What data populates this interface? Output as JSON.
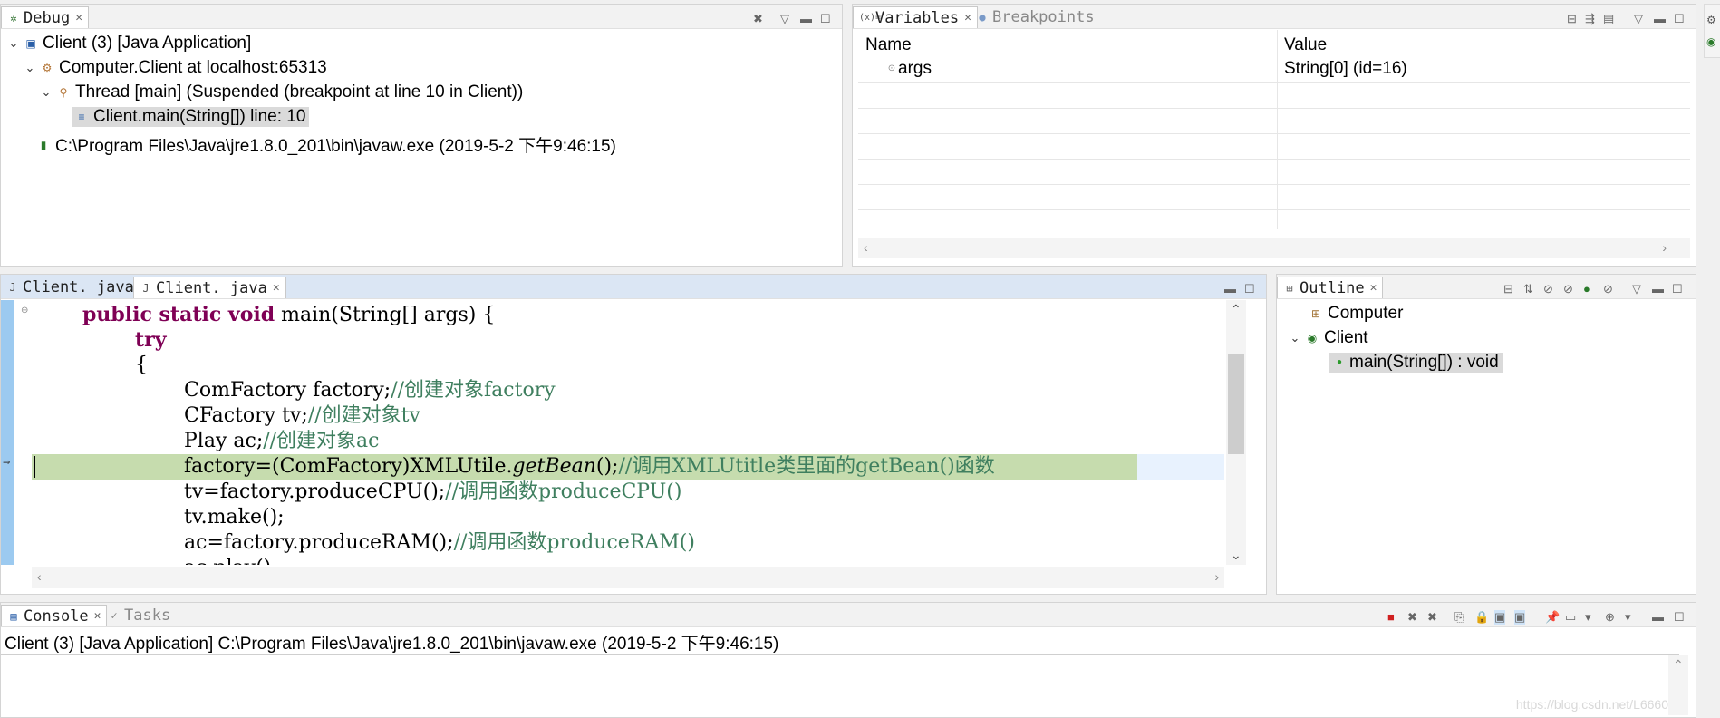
{
  "debug": {
    "tab_label": "Debug",
    "tree": [
      {
        "label": "Client (3) [Java Application]"
      },
      {
        "label": "Computer.Client at localhost:65313"
      },
      {
        "label": "Thread [main] (Suspended (breakpoint at line 10 in Client))"
      },
      {
        "label": "Client.main(String[]) line: 10"
      },
      {
        "label": "C:\\Program Files\\Java\\jre1.8.0_201\\bin\\javaw.exe (2019-5-2 下午9:46:15)"
      }
    ]
  },
  "variables": {
    "tabs": [
      "Variables",
      "Breakpoints"
    ],
    "columns": [
      "Name",
      "Value"
    ],
    "rows": [
      {
        "name": "args",
        "value": "String[0]  (id=16)"
      }
    ]
  },
  "editor": {
    "tabs": [
      "Client. java",
      "Client. java"
    ],
    "lines": {
      "l1_kw": "public static void",
      "l1_rest": " main(String[] args) {",
      "l2_kw": "try",
      "l3": "{",
      "l4_code": "ComFactory factory;",
      "l4_cmt": "//创建对象factory",
      "l5_code": "CFactory tv;",
      "l5_cmt": "//创建对象tv",
      "l6_code": "Play ac;",
      "l6_cmt": "//创建对象ac",
      "l7_code_a": "factory=(ComFactory)XMLUtile.",
      "l7_code_b": "getBean",
      "l7_code_c": "();",
      "l7_cmt": "//调用XMLUtitle类里面的getBean()函数",
      "l8_code": "tv=factory.produceCPU();",
      "l8_cmt": "//调用函数produceCPU()",
      "l9_code": "tv.make();",
      "l10_code": "ac=factory.produceRAM();",
      "l10_cmt": "//调用函数produceRAM()",
      "l11_code": "ac.play();"
    },
    "highlight_color": "#c6dcae"
  },
  "outline": {
    "tab_label": "Outline",
    "items": [
      {
        "label": "Computer"
      },
      {
        "label": "Client"
      },
      {
        "label": "main(String[]) : void"
      }
    ]
  },
  "console": {
    "tabs": [
      "Console",
      "Tasks"
    ],
    "header": "Client (3) [Java Application] C:\\Program Files\\Java\\jre1.8.0_201\\bin\\javaw.exe (2019-5-2 下午9:46:15)"
  },
  "watermark": "https://blog.csdn.net/L6660"
}
